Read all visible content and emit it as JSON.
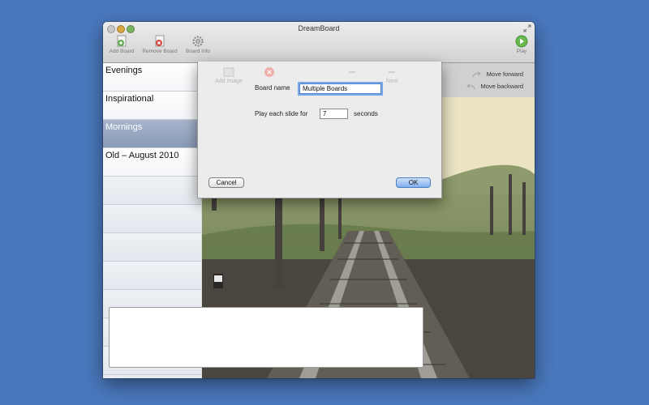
{
  "window": {
    "title": "DreamBoard"
  },
  "toolbar": {
    "add_label": "Add Board",
    "remove_label": "Remove Board",
    "info_label": "Board Info",
    "play_label": "Play"
  },
  "sidebar": {
    "items": [
      {
        "label": "Evenings",
        "selected": false
      },
      {
        "label": "Inspirational",
        "selected": false
      },
      {
        "label": "Mornings",
        "selected": true
      },
      {
        "label": "Old – August 2010",
        "selected": false
      }
    ]
  },
  "main": {
    "ghost_add_image": "Add Image",
    "ghost_next": "Next",
    "move_forward": "Move forward",
    "move_backward": "Move backward"
  },
  "sheet": {
    "board_name_label": "Board name",
    "board_name_value": "Multiple Boards",
    "slide_label": "Play each slide for",
    "slide_value": "7",
    "slide_unit": "seconds",
    "cancel_label": "Cancel",
    "ok_label": "OK"
  },
  "colors": {
    "desktop": "#4a78bd",
    "selected_row": "#95a6c0",
    "ok_button": "#7fb0ee"
  }
}
